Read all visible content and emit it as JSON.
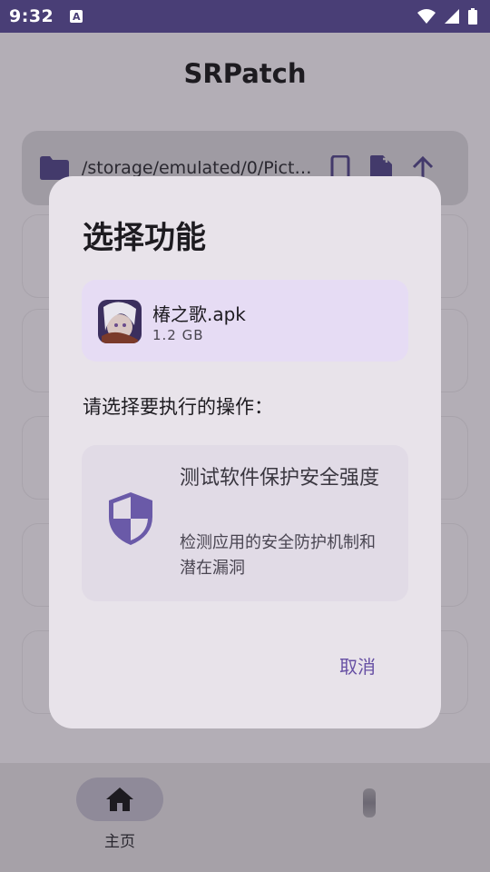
{
  "status": {
    "time": "9:32",
    "notification_letter": "A"
  },
  "app": {
    "title": "SRPatch",
    "path": "/storage/emulated/0/Pictures"
  },
  "nav": {
    "home_label": "主页"
  },
  "dialog": {
    "title": "选择功能",
    "file": {
      "name": "椿之歌.apk",
      "size": "1.2 GB"
    },
    "prompt": "请选择要执行的操作：",
    "option": {
      "title": "测试软件保护安全强度",
      "description": "检测应用的安全防护机制和潜在漏洞"
    },
    "cancel_label": "取消"
  },
  "colors": {
    "accent": "#6750a4",
    "status_bar": "#493e76"
  }
}
